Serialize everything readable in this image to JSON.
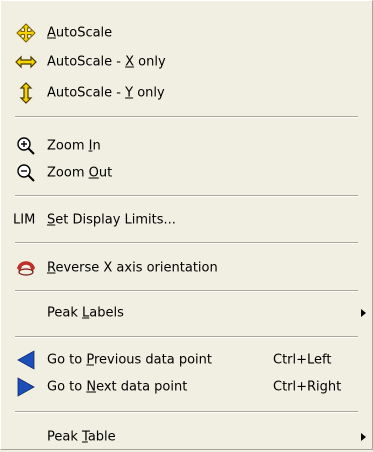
{
  "menu": {
    "autoscale": {
      "pre": "",
      "mnemonic": "A",
      "post": "utoScale",
      "icon": "move-arrows-icon"
    },
    "autoscale_x": {
      "pre": "AutoScale - ",
      "mnemonic": "X",
      "post": " only",
      "icon": "horizontal-double-arrow-icon"
    },
    "autoscale_y": {
      "pre": "AutoScale - ",
      "mnemonic": "Y",
      "post": " only",
      "icon": "vertical-double-arrow-icon"
    },
    "zoom_in": {
      "pre": "Zoom ",
      "mnemonic": "I",
      "post": "n",
      "icon": "zoom-in-icon"
    },
    "zoom_out": {
      "pre": "Zoom ",
      "mnemonic": "O",
      "post": "ut",
      "icon": "zoom-out-icon"
    },
    "display_limits": {
      "icon_text": "LIM",
      "pre": "",
      "mnemonic": "S",
      "post": "et Display Limits...",
      "icon": "lim-icon"
    },
    "reverse_x": {
      "pre": "",
      "mnemonic": "R",
      "post": "everse X axis orientation",
      "icon": "reverse-arrow-icon"
    },
    "peak_labels": {
      "pre": "Peak ",
      "mnemonic": "L",
      "post": "abels"
    },
    "prev_point": {
      "pre": "Go to ",
      "mnemonic": "P",
      "post": "revious data point",
      "shortcut": "Ctrl+Left",
      "icon": "triangle-left-icon"
    },
    "next_point": {
      "pre": "Go to ",
      "mnemonic": "N",
      "post": "ext data point",
      "shortcut": "Ctrl+Right",
      "icon": "triangle-right-icon"
    },
    "peak_table": {
      "pre": "Peak ",
      "mnemonic": "T",
      "post": "able"
    }
  },
  "colors": {
    "menu_bg": "#f1efe2",
    "icon_yellow": "#f5d400",
    "icon_blue": "#1d4fb8",
    "icon_red": "#c0302a"
  }
}
